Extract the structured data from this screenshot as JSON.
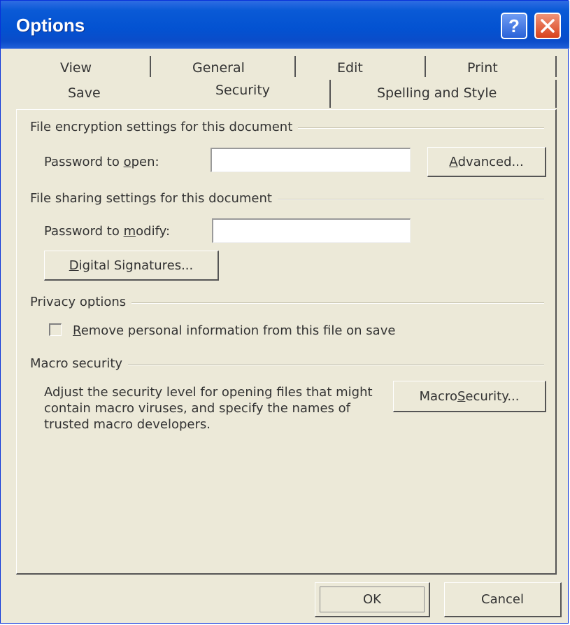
{
  "window": {
    "title": "Options",
    "help_glyph": "?",
    "close_glyph": "✕"
  },
  "tabs": {
    "row1": [
      "View",
      "General",
      "Edit",
      "Print"
    ],
    "row2": [
      "Save",
      "Security",
      "Spelling and Style"
    ],
    "active": "Security"
  },
  "encryption": {
    "heading": "File encryption settings for this document",
    "password_label_pre": "Password to ",
    "password_label_key": "o",
    "password_label_post": "pen:",
    "password_value": "",
    "advanced_pre": "",
    "advanced_key": "A",
    "advanced_post": "dvanced..."
  },
  "sharing": {
    "heading": "File sharing settings for this document",
    "password_label_pre": "Password to ",
    "password_label_key": "m",
    "password_label_post": "odify:",
    "password_value": "",
    "digsig_pre": "",
    "digsig_key": "D",
    "digsig_post": "igital Signatures..."
  },
  "privacy": {
    "heading": "Privacy options",
    "checkbox_checked": false,
    "checkbox_key": "R",
    "checkbox_post": "emove personal information from this file on save"
  },
  "macro": {
    "heading": "Macro security",
    "description": "Adjust the security level for opening files that might contain macro viruses, and specify the names of trusted macro developers.",
    "button_pre": "Macro ",
    "button_key": "S",
    "button_post": "ecurity..."
  },
  "footer": {
    "ok_label": "OK",
    "cancel_label": "Cancel"
  }
}
